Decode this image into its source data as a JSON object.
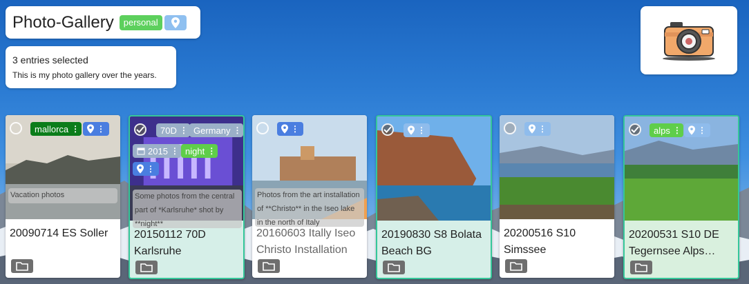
{
  "header": {
    "title": "Photo-Gallery",
    "tag": "personal",
    "location_icon": "map-pin-icon"
  },
  "info": {
    "selection": "3 entries selected",
    "description": "This is my photo gallery over the years."
  },
  "logo_icon": "camera-icon",
  "cards": [
    {
      "name": "20090714 ES Soller",
      "desc": "Vacation photos",
      "tags": [
        "mallorca"
      ],
      "selected": false
    },
    {
      "name": "20150112 70D Karlsruhe",
      "desc": "Some photos from the central part of *Karlsruhe* shot by **night**",
      "tags": [
        "70D",
        "Germany",
        "2015",
        "night"
      ],
      "selected": true
    },
    {
      "name": "20160603 Itally Iseo Christo Installation",
      "desc": "Photos from the art installation of **Christo** in the Iseo lake in the north of Italy",
      "tags": [],
      "selected": false
    },
    {
      "name": "20190830 S8 Bolata Beach BG",
      "desc": "",
      "tags": [],
      "selected": true
    },
    {
      "name": "20200516 S10 Simssee",
      "desc": "",
      "tags": [],
      "selected": false
    },
    {
      "name": "20200531 S10 DE Tegernsee Alps…",
      "desc": "",
      "tags": [
        "alps"
      ],
      "selected": true
    }
  ],
  "colors": {
    "selected_border": "#35c79a",
    "tag_green": "#5dd05d",
    "tag_blue": "#4a7ee0"
  }
}
